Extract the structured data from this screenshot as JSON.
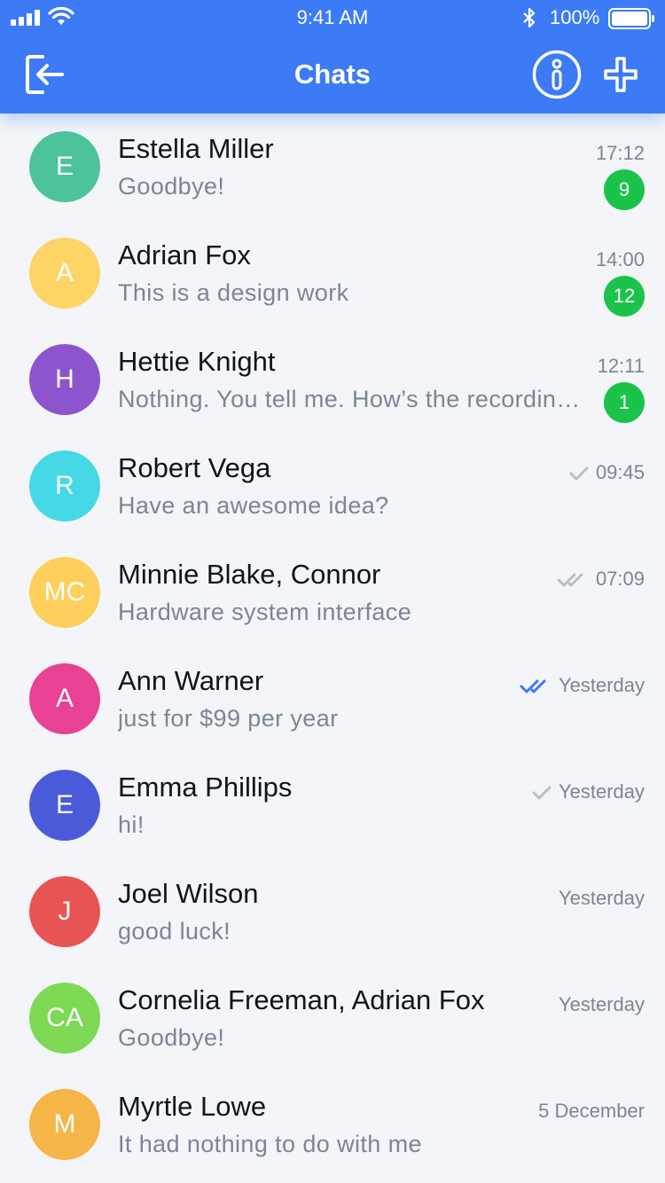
{
  "status_bar": {
    "time": "9:41 AM",
    "battery": "100%"
  },
  "nav": {
    "title": "Chats",
    "left_icon": "logout-icon",
    "right_icons": [
      "info-icon",
      "plus-icon"
    ]
  },
  "colors": {
    "header": "#3d7bf6",
    "badge": "#1ac349",
    "read_check": "#3d7bf6",
    "sent_check": "#b8bec8"
  },
  "chats": [
    {
      "initials": "E",
      "name": "Estella Miller",
      "message": "Goodbye!",
      "time": "17:12",
      "unread": "9",
      "status": "",
      "avatar_color": "#4cc39b"
    },
    {
      "initials": "A",
      "name": "Adrian Fox",
      "message": "This is a design work",
      "time": "14:00",
      "unread": "12",
      "status": "",
      "avatar_color": "#fdd466"
    },
    {
      "initials": "H",
      "name": "Hettie Knight",
      "message": "Nothing. You tell me. How’s the recording going?",
      "time": "12:11",
      "unread": "1",
      "status": "",
      "avatar_color": "#8e54cd"
    },
    {
      "initials": "R",
      "name": "Robert Vega",
      "message": "Have an awesome idea?",
      "time": "09:45",
      "unread": "",
      "status": "sent",
      "avatar_color": "#45d9e6"
    },
    {
      "initials": "MC",
      "name": "Minnie Blake, Connor",
      "message": "Hardware system interface",
      "time": "07:09",
      "unread": "",
      "status": "delivered",
      "avatar_color": "#fecf5a"
    },
    {
      "initials": "A",
      "name": "Ann Warner",
      "message": "just for $99 per year",
      "time": "Yesterday",
      "unread": "",
      "status": "read",
      "avatar_color": "#e94193"
    },
    {
      "initials": "E",
      "name": "Emma Phillips",
      "message": "hi!",
      "time": "Yesterday",
      "unread": "",
      "status": "sent",
      "avatar_color": "#4a5bda"
    },
    {
      "initials": "J",
      "name": "Joel Wilson",
      "message": "good luck!",
      "time": "Yesterday",
      "unread": "",
      "status": "",
      "avatar_color": "#e85453"
    },
    {
      "initials": "CA",
      "name": "Cornelia Freeman, Adrian Fox",
      "message": "Goodbye!",
      "time": "Yesterday",
      "unread": "",
      "status": "",
      "avatar_color": "#7ed955"
    },
    {
      "initials": "M",
      "name": "Myrtle Lowe",
      "message": "It had nothing to do with me",
      "time": "5 December",
      "unread": "",
      "status": "",
      "avatar_color": "#f6b547"
    }
  ]
}
